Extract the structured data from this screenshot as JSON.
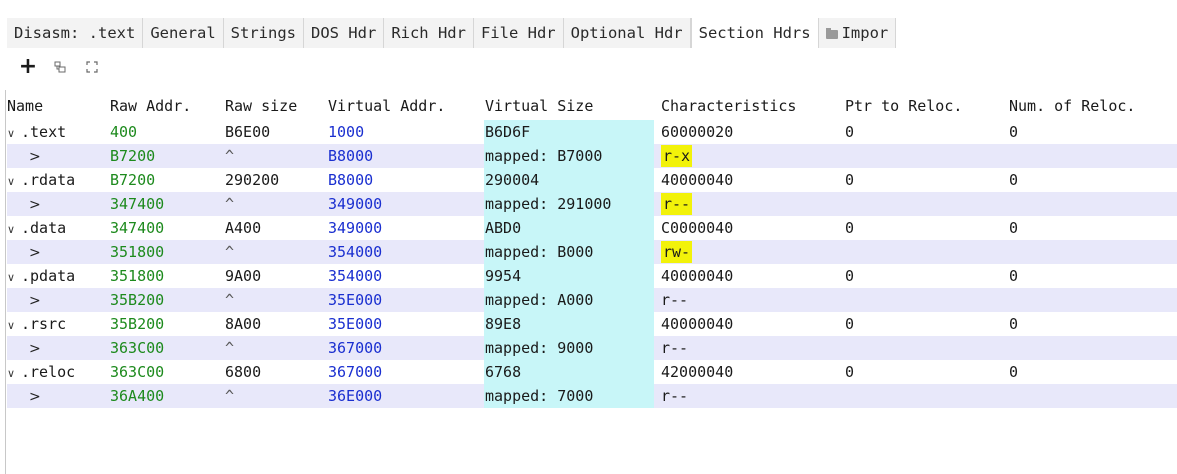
{
  "tabs": [
    {
      "label": "Disasm: .text",
      "active": false
    },
    {
      "label": "General",
      "active": false
    },
    {
      "label": "Strings",
      "active": false
    },
    {
      "label": "DOS Hdr",
      "active": false
    },
    {
      "label": "Rich Hdr",
      "active": false
    },
    {
      "label": "File Hdr",
      "active": false
    },
    {
      "label": "Optional Hdr",
      "active": false
    },
    {
      "label": "Section Hdrs",
      "active": true
    },
    {
      "label": "Impor",
      "active": false,
      "icon": "folder-icon"
    }
  ],
  "toolbar": {
    "add_icon": "plus-icon",
    "add_label": "+",
    "copy_icon": "copy-icon",
    "expand_icon": "expand-icon"
  },
  "table": {
    "headers": [
      "Name",
      "Raw Addr.",
      "Raw size",
      "Virtual Addr.",
      "Virtual Size",
      "Characteristics",
      "Ptr to Reloc.",
      "Num. of Reloc."
    ],
    "rows": [
      {
        "kind": "section",
        "name": ".text",
        "raw_addr": "400",
        "raw_size": "B6E00",
        "virt_addr": "1000",
        "virt_size": "B6D6F",
        "characteristics": "60000020",
        "ptr_reloc": "0",
        "num_reloc": "0"
      },
      {
        "kind": "mapped",
        "name": ">",
        "raw_addr": "B7200",
        "raw_size": "^",
        "virt_addr": "B8000",
        "virt_size": "mapped: B7000",
        "characteristics": "r-x",
        "highlight": true
      },
      {
        "kind": "section",
        "name": ".rdata",
        "raw_addr": "B7200",
        "raw_size": "290200",
        "virt_addr": "B8000",
        "virt_size": "290004",
        "characteristics": "40000040",
        "ptr_reloc": "0",
        "num_reloc": "0"
      },
      {
        "kind": "mapped",
        "name": ">",
        "raw_addr": "347400",
        "raw_size": "^",
        "virt_addr": "349000",
        "virt_size": "mapped: 291000",
        "characteristics": "r--",
        "highlight": true
      },
      {
        "kind": "section",
        "name": ".data",
        "raw_addr": "347400",
        "raw_size": "A400",
        "virt_addr": "349000",
        "virt_size": "ABD0",
        "characteristics": "C0000040",
        "ptr_reloc": "0",
        "num_reloc": "0"
      },
      {
        "kind": "mapped",
        "name": ">",
        "raw_addr": "351800",
        "raw_size": "^",
        "virt_addr": "354000",
        "virt_size": "mapped: B000",
        "characteristics": "rw-",
        "highlight": true
      },
      {
        "kind": "section",
        "name": ".pdata",
        "raw_addr": "351800",
        "raw_size": "9A00",
        "virt_addr": "354000",
        "virt_size": "9954",
        "characteristics": "40000040",
        "ptr_reloc": "0",
        "num_reloc": "0"
      },
      {
        "kind": "mapped",
        "name": ">",
        "raw_addr": "35B200",
        "raw_size": "^",
        "virt_addr": "35E000",
        "virt_size": "mapped: A000",
        "characteristics": "r--",
        "highlight": false
      },
      {
        "kind": "section",
        "name": ".rsrc",
        "raw_addr": "35B200",
        "raw_size": "8A00",
        "virt_addr": "35E000",
        "virt_size": "89E8",
        "characteristics": "40000040",
        "ptr_reloc": "0",
        "num_reloc": "0"
      },
      {
        "kind": "mapped",
        "name": ">",
        "raw_addr": "363C00",
        "raw_size": "^",
        "virt_addr": "367000",
        "virt_size": "mapped: 9000",
        "characteristics": "r--",
        "highlight": false
      },
      {
        "kind": "section",
        "name": ".reloc",
        "raw_addr": "363C00",
        "raw_size": "6800",
        "virt_addr": "367000",
        "virt_size": "6768",
        "characteristics": "42000040",
        "ptr_reloc": "0",
        "num_reloc": "0"
      },
      {
        "kind": "mapped",
        "name": ">",
        "raw_addr": "36A400",
        "raw_size": "^",
        "virt_addr": "36E000",
        "virt_size": "mapped: 7000",
        "characteristics": "r--",
        "highlight": false
      }
    ]
  },
  "colors": {
    "raw_addr": "#1d8a1d",
    "virt_addr": "#1a2fd0",
    "virtual_size_bg": "#c8f6f8",
    "mapped_row_bg": "#e8e8fa",
    "characteristics_highlight": "#f2f20a"
  }
}
